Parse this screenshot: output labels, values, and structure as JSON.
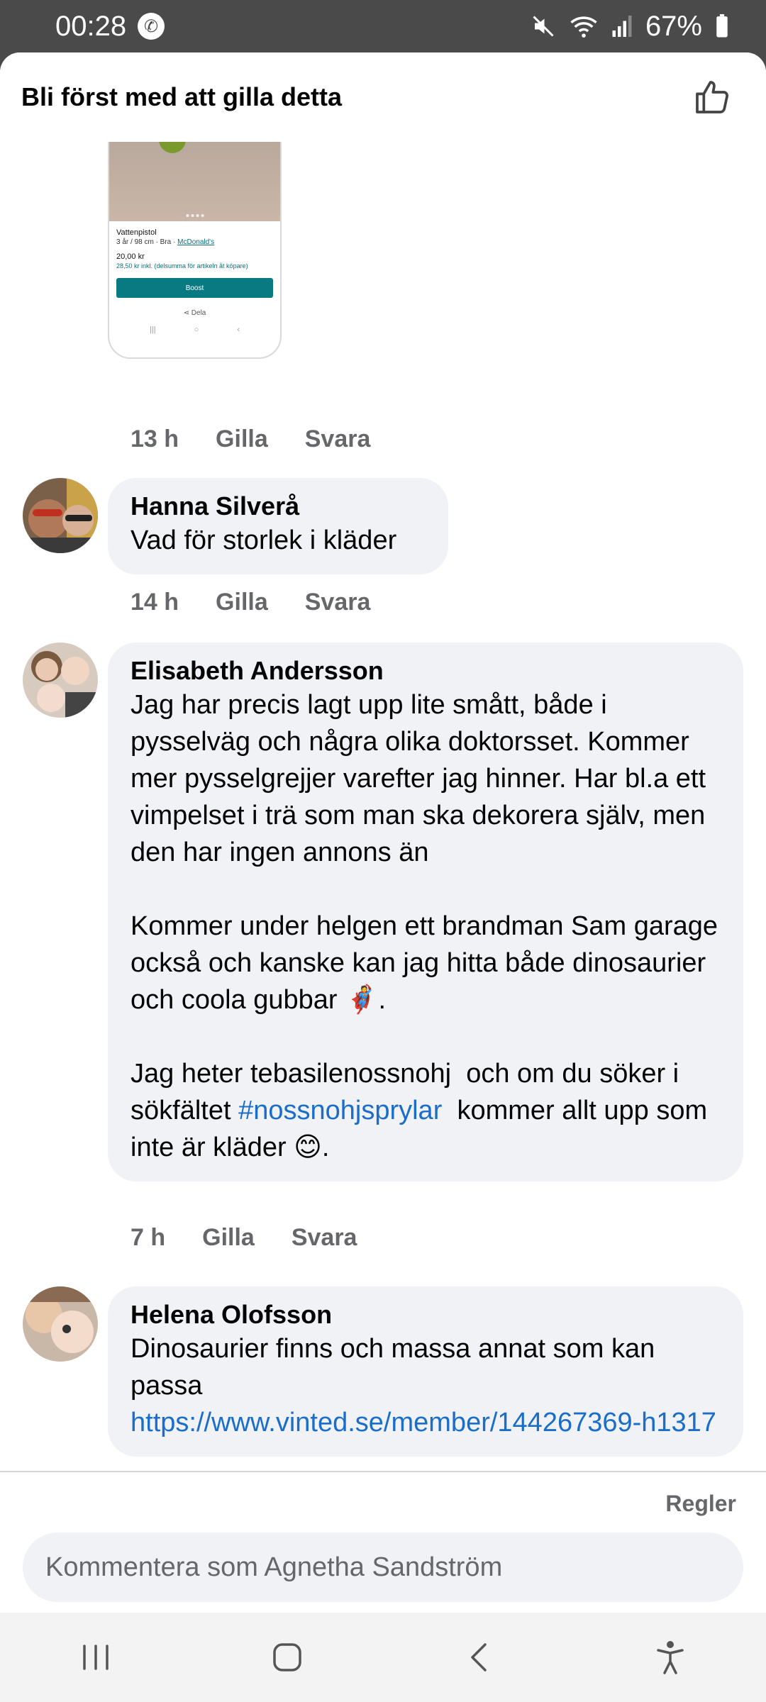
{
  "status_bar": {
    "time": "00:28",
    "battery": "67%",
    "icons": [
      "phone-call-icon",
      "mute-icon",
      "wifi-icon",
      "signal-icon",
      "battery-icon"
    ]
  },
  "header": {
    "title": "Bli först med att gilla detta",
    "like_icon": "thumbs-up-icon"
  },
  "attachment": {
    "item_title": "Vattenpistol",
    "item_meta": "3 år / 98 cm · Bra ·",
    "item_brand": "McDonald's",
    "price": "20,00 kr",
    "price_incl": "28,50 kr inkl. (delsumma för artikeln åt köpare)",
    "boost_label": "Boost",
    "share_label": "Dela"
  },
  "first_actions": {
    "time": "13 h",
    "like": "Gilla",
    "reply": "Svara"
  },
  "comments": [
    {
      "author": "Hanna Silverå",
      "text": "Vad för storlek i kläder",
      "time": "14 h",
      "like": "Gilla",
      "reply": "Svara"
    },
    {
      "author": "Elisabeth Andersson",
      "text_p1": "Jag har precis lagt upp lite smått, både i pysselväg och några olika doktorsset. Kommer mer pysselgrejjer varefter jag hinner. Har bl.a ett vimpelset i trä som man ska dekorera själv, men den har ingen annons än",
      "text_p2": "Kommer under helgen ett brandman Sam garage också och kanske kan jag hitta både dinosaurier och coola gubbar ",
      "emoji_superhero": "🦸",
      "text_p2_end": ".",
      "text_p3_a": "Jag heter tebasilenossnohj  och om du söker i sökfältet ",
      "hashtag": "#nossnohjsprylar",
      "text_p3_b": "  kommer allt upp som inte är kläder ",
      "emoji_smile": "😊",
      "text_p3_end": ".",
      "time": "7 h",
      "like": "Gilla",
      "reply": "Svara"
    },
    {
      "author": "Helena Olofsson",
      "text": "Dinosaurier finns och massa annat som kan passa",
      "link": "https://www.vinted.se/member/144267369-h1317"
    }
  ],
  "footer": {
    "rules_label": "Regler",
    "comment_placeholder": "Kommentera som Agnetha Sandström"
  },
  "navbar": {
    "items": [
      "recent-apps-icon",
      "home-icon",
      "back-icon",
      "accessibility-icon"
    ]
  },
  "colors": {
    "link": "#1a6ec9",
    "bubble": "#f0f2f5",
    "muted": "#65676b",
    "status_bg": "#4a4a4a"
  }
}
